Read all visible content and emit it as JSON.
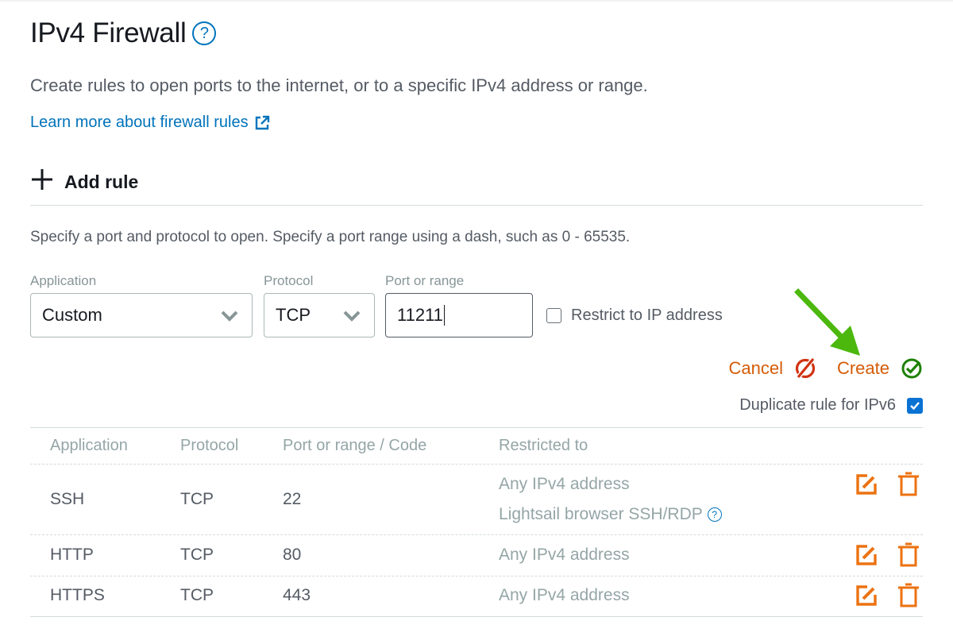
{
  "header": {
    "title": "IPv4 Firewall",
    "help_icon": "?",
    "description": "Create rules to open ports to the internet, or to a specific IPv4 address or range.",
    "learn_more_link": "Learn more about firewall rules"
  },
  "add_rule": {
    "plus_icon": "+",
    "label": "Add rule",
    "instructions": "Specify a port and protocol to open. Specify a port range using a dash, such as 0 - 65535.",
    "application": {
      "label": "Application",
      "value": "Custom"
    },
    "protocol": {
      "label": "Protocol",
      "value": "TCP"
    },
    "port": {
      "label": "Port or range",
      "value": "11211"
    },
    "restrict_checkbox": {
      "label": "Restrict to IP address",
      "checked": false
    },
    "cancel_label": "Cancel",
    "create_label": "Create",
    "duplicate_checkbox": {
      "label": "Duplicate rule for IPv6",
      "checked": true
    }
  },
  "colors": {
    "link": "#0073bb",
    "action": "#d45b07",
    "cancel_icon": "#d13212",
    "create_icon": "#1d8102",
    "annotation_arrow": "#4cb80e",
    "checkbox": "#0972d3"
  },
  "table": {
    "headers": [
      "Application",
      "Protocol",
      "Port or range / Code",
      "Restricted to"
    ],
    "rows": [
      {
        "application": "SSH",
        "protocol": "TCP",
        "port": "22",
        "restricted": "Any IPv4 address",
        "restricted_extra": "Lightsail browser SSH/RDP",
        "help_icon": "?"
      },
      {
        "application": "HTTP",
        "protocol": "TCP",
        "port": "80",
        "restricted": "Any IPv4 address"
      },
      {
        "application": "HTTPS",
        "protocol": "TCP",
        "port": "443",
        "restricted": "Any IPv4 address"
      }
    ]
  }
}
